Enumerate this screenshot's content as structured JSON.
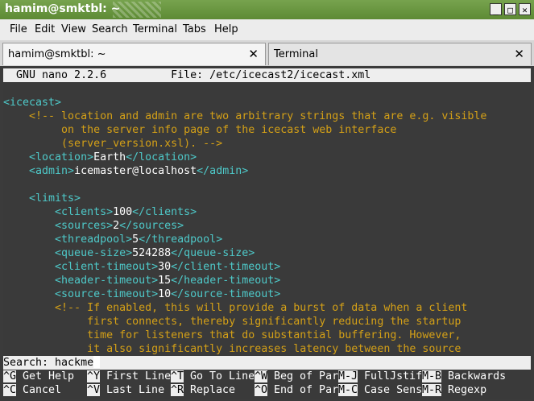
{
  "window": {
    "title": "hamim@smktbl: ~",
    "buttons": [
      "_",
      "□",
      "✕"
    ]
  },
  "menubar": [
    "File",
    "Edit",
    "View",
    "Search",
    "Terminal",
    "Tabs",
    "Help"
  ],
  "tabs": [
    {
      "label": "hamim@smktbl: ~",
      "close": "✕"
    },
    {
      "label": "Terminal",
      "close": "✕"
    }
  ],
  "nano": {
    "header": "  GNU nano 2.2.6          File: /etc/icecast2/icecast.xml",
    "search_prompt": "Search: hackme",
    "shortcuts_row1": [
      {
        "key": "^G",
        "label": " Get Help  "
      },
      {
        "key": "^Y",
        "label": " First Line"
      },
      {
        "key": "^T",
        "label": " Go To Line"
      },
      {
        "key": "^W",
        "label": " Beg of Par"
      },
      {
        "key": "M-J",
        "label": " FullJstif"
      },
      {
        "key": "M-B",
        "label": " Backwards"
      }
    ],
    "shortcuts_row2": [
      {
        "key": "^C",
        "label": " Cancel    "
      },
      {
        "key": "^V",
        "label": " Last Line "
      },
      {
        "key": "^R",
        "label": " Replace   "
      },
      {
        "key": "^O",
        "label": " End of Par"
      },
      {
        "key": "M-C",
        "label": " Case Sens"
      },
      {
        "key": "M-R",
        "label": " Regexp"
      }
    ]
  },
  "lines": [
    [],
    [
      {
        "c": "tag",
        "t": "<icecast>"
      }
    ],
    [
      {
        "c": "cmt",
        "t": "    <!-- location and admin are two arbitrary strings that are e.g. visible"
      }
    ],
    [
      {
        "c": "cmt",
        "t": "         on the server info page of the icecast web interface"
      }
    ],
    [
      {
        "c": "cmt",
        "t": "         (server_version.xsl). -->"
      }
    ],
    [
      {
        "c": "tag",
        "t": "    <location>"
      },
      {
        "c": "txt",
        "t": "Earth"
      },
      {
        "c": "tag",
        "t": "</location>"
      }
    ],
    [
      {
        "c": "tag",
        "t": "    <admin>"
      },
      {
        "c": "txt",
        "t": "icemaster@localhost"
      },
      {
        "c": "tag",
        "t": "</admin>"
      }
    ],
    [],
    [
      {
        "c": "tag",
        "t": "    <limits>"
      }
    ],
    [
      {
        "c": "tag",
        "t": "        <clients>"
      },
      {
        "c": "txt",
        "t": "100"
      },
      {
        "c": "tag",
        "t": "</clients>"
      }
    ],
    [
      {
        "c": "tag",
        "t": "        <sources>"
      },
      {
        "c": "txt",
        "t": "2"
      },
      {
        "c": "tag",
        "t": "</sources>"
      }
    ],
    [
      {
        "c": "tag",
        "t": "        <threadpool>"
      },
      {
        "c": "txt",
        "t": "5"
      },
      {
        "c": "tag",
        "t": "</threadpool>"
      }
    ],
    [
      {
        "c": "tag",
        "t": "        <queue-size>"
      },
      {
        "c": "txt",
        "t": "524288"
      },
      {
        "c": "tag",
        "t": "</queue-size>"
      }
    ],
    [
      {
        "c": "tag",
        "t": "        <client-timeout>"
      },
      {
        "c": "txt",
        "t": "30"
      },
      {
        "c": "tag",
        "t": "</client-timeout>"
      }
    ],
    [
      {
        "c": "tag",
        "t": "        <header-timeout>"
      },
      {
        "c": "txt",
        "t": "15"
      },
      {
        "c": "tag",
        "t": "</header-timeout>"
      }
    ],
    [
      {
        "c": "tag",
        "t": "        <source-timeout>"
      },
      {
        "c": "txt",
        "t": "10"
      },
      {
        "c": "tag",
        "t": "</source-timeout>"
      }
    ],
    [
      {
        "c": "cmt",
        "t": "        <!-- If enabled, this will provide a burst of data when a client"
      }
    ],
    [
      {
        "c": "cmt",
        "t": "             first connects, thereby significantly reducing the startup"
      }
    ],
    [
      {
        "c": "cmt",
        "t": "             time for listeners that do substantial buffering. However,"
      }
    ],
    [
      {
        "c": "cmt",
        "t": "             it also significantly increases latency between the source"
      }
    ]
  ]
}
